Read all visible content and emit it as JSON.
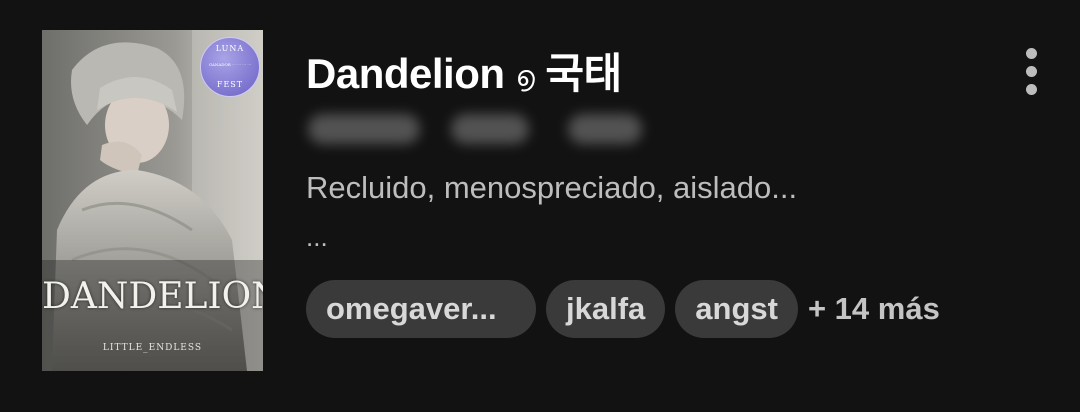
{
  "story": {
    "title": "Dandelion",
    "title_glyph": "൭",
    "title_korean": "국태",
    "description": "Recluido, menospreciado, aislado...",
    "description_continued": "...",
    "tags": [
      "omegaver...",
      "jkalfa",
      "angst"
    ],
    "more_tags": "+ 14 más"
  },
  "cover": {
    "title": "DANDELION",
    "author": "LITTLE_ENDLESS",
    "badge_top": "LUNA",
    "badge_middle": "GANADOR ··· ··· ··· ···",
    "badge_bottom": "FEST"
  },
  "icons": {
    "menu": "more-vertical-icon"
  },
  "colors": {
    "background": "#121212",
    "title": "#ffffff",
    "text_secondary": "#bdbdbd",
    "tag_background": "#3a3a3a",
    "badge": "#7d74cf"
  }
}
